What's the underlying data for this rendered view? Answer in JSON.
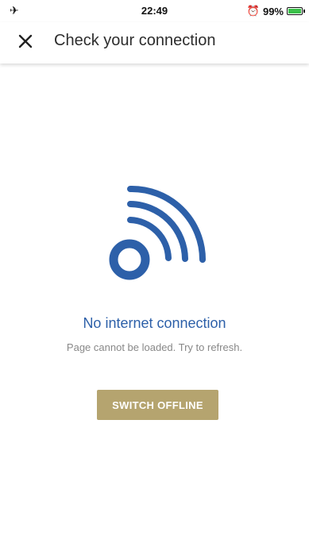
{
  "status_bar": {
    "time": "22:49",
    "battery_percent": "99%",
    "icons": [
      "airplane-icon",
      "alarm-icon",
      "battery-icon"
    ]
  },
  "header": {
    "title": "Check your connection",
    "close_icon": "close-icon"
  },
  "message": {
    "title": "No internet connection",
    "subtitle": "Page cannot be loaded. Try to refresh.",
    "icon": "wifi-signal-icon",
    "accent_color": "#2d60a9"
  },
  "actions": {
    "switch_offline_label": "SWITCH OFFLINE",
    "button_color": "#b5a46f"
  }
}
